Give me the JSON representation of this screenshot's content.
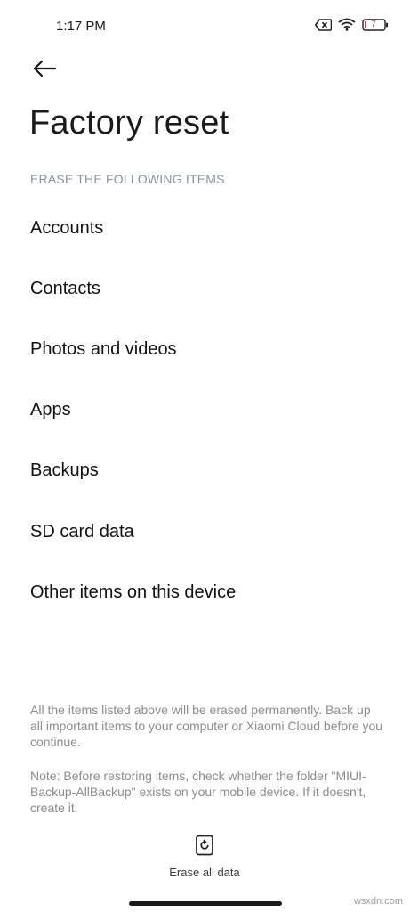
{
  "status_bar": {
    "time": "1:17 PM",
    "icons": [
      "sim-off-icon",
      "wifi-icon",
      "battery-icon"
    ],
    "battery_level": "7",
    "battery_color": "#e53935"
  },
  "header": {
    "back_icon": "arrow-left-icon",
    "title": "Factory reset"
  },
  "section": {
    "heading": "ERASE THE FOLLOWING ITEMS",
    "items": [
      {
        "label": "Accounts"
      },
      {
        "label": "Contacts"
      },
      {
        "label": "Photos and videos"
      },
      {
        "label": "Apps"
      },
      {
        "label": "Backups"
      },
      {
        "label": "SD card data"
      },
      {
        "label": "Other items on this device"
      }
    ]
  },
  "notes": {
    "warning": "All the items listed above will be erased permanently. Back up all important items to your computer or Xiaomi Cloud before you continue.",
    "note": "Note: Before restoring items, check whether the folder \"MIUI-Backup-AllBackup\" exists on your mobile device. If it doesn't, create it."
  },
  "footer": {
    "erase_icon": "reset-icon",
    "erase_label": "Erase all data"
  },
  "watermark": "wsxdn.com",
  "colors": {
    "section_heading": "#8a93a3",
    "note_text": "#8c8c8c",
    "background": "#ffffff"
  }
}
